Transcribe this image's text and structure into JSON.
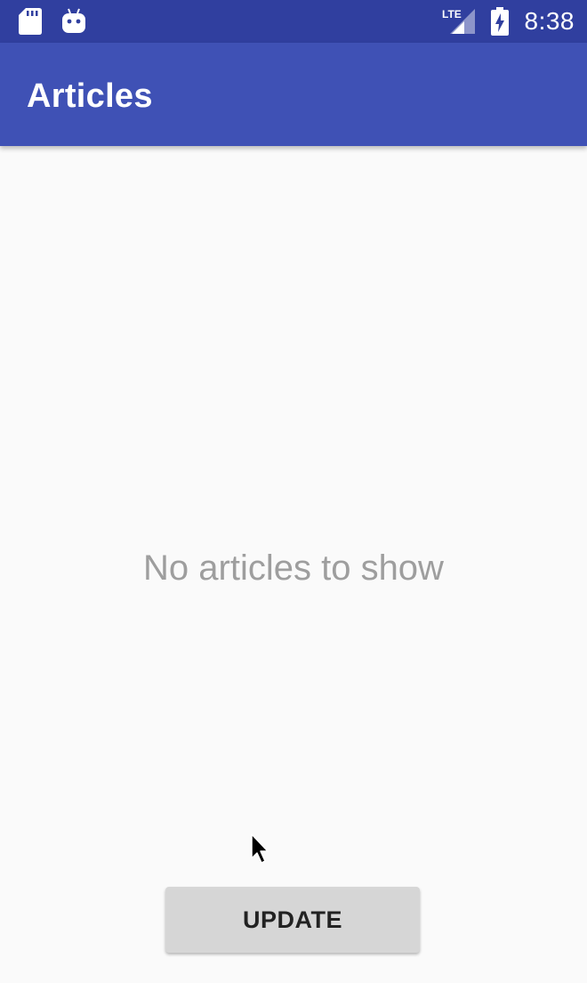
{
  "status_bar": {
    "time": "8:38",
    "network_label": "LTE",
    "icons": [
      "sd-card-icon",
      "android-debug-icon",
      "lte-signal-icon",
      "battery-charging-icon"
    ],
    "background_color": "#303f9f"
  },
  "app_bar": {
    "title": "Articles",
    "background_color": "#3f51b5"
  },
  "main": {
    "empty_message": "No articles to show",
    "update_button_label": "UPDATE"
  }
}
